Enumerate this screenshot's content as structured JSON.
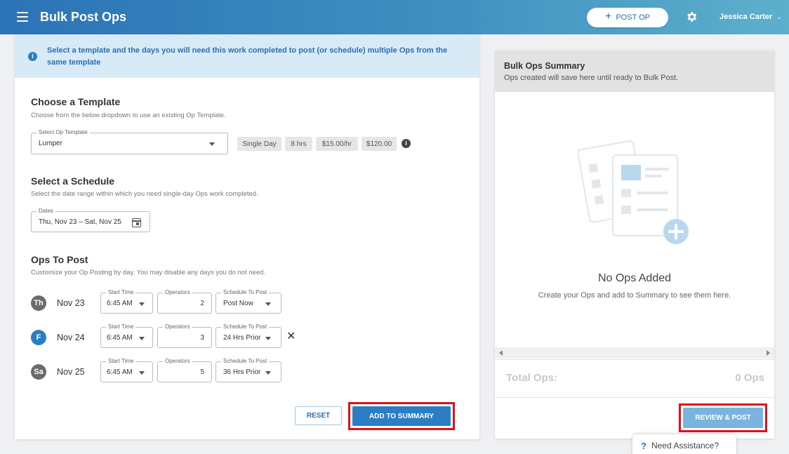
{
  "header": {
    "title": "Bulk Post Ops",
    "post_op_label": "POST OP",
    "user_name": "Jessica Carter"
  },
  "banner": {
    "text": "Select a template and the days you will need this work completed to post (or schedule) multiple Ops from the same template"
  },
  "template_section": {
    "title": "Choose a Template",
    "subtitle": "Choose from the below dropdown to use an existing Op Template.",
    "select_label": "Select Op Template",
    "select_value": "Lumper",
    "chips": [
      "Single Day",
      "8 hrs",
      "$15.00/hr",
      "$120.00"
    ]
  },
  "schedule_section": {
    "title": "Select a Schedule",
    "subtitle": "Select the date range within which you need single-day Ops work completed.",
    "dates_label": "Dates",
    "dates_value": "Thu, Nov 23 – Sat, Nov 25"
  },
  "ops_section": {
    "title": "Ops To Post",
    "subtitle": "Customize your Op Posting by day. You may disable any days you do not need.",
    "start_time_label": "Start Time",
    "operators_label": "Operators",
    "schedule_label": "Schedule To Post",
    "rows": [
      {
        "day": "Th",
        "date": "Nov 23",
        "start_time": "6:45 AM",
        "operators": "2",
        "schedule": "Post Now",
        "badge_color": "#6b6b6b"
      },
      {
        "day": "F",
        "date": "Nov 24",
        "start_time": "6:45 AM",
        "operators": "3",
        "schedule": "24 Hrs Prior",
        "badge_color": "#2a7fc4"
      },
      {
        "day": "Sa",
        "date": "Nov 25",
        "start_time": "6:45 AM",
        "operators": "5",
        "schedule": "36 Hrs Prior",
        "badge_color": "#6b6b6b"
      }
    ]
  },
  "actions": {
    "reset_label": "RESET",
    "add_label": "ADD TO SUMMARY"
  },
  "summary": {
    "title": "Bulk Ops Summary",
    "subtitle": "Ops created will save here until ready to Bulk Post.",
    "empty_title": "No Ops Added",
    "empty_sub": "Create your Ops and add to Summary to see them here.",
    "total_label": "Total Ops:",
    "total_value": "0 Ops",
    "review_label": "REVIEW & POST"
  },
  "assist": {
    "label": "Need Assistance?"
  },
  "colors": {
    "accent": "#2a7fc4",
    "highlight": "#e0101a"
  }
}
